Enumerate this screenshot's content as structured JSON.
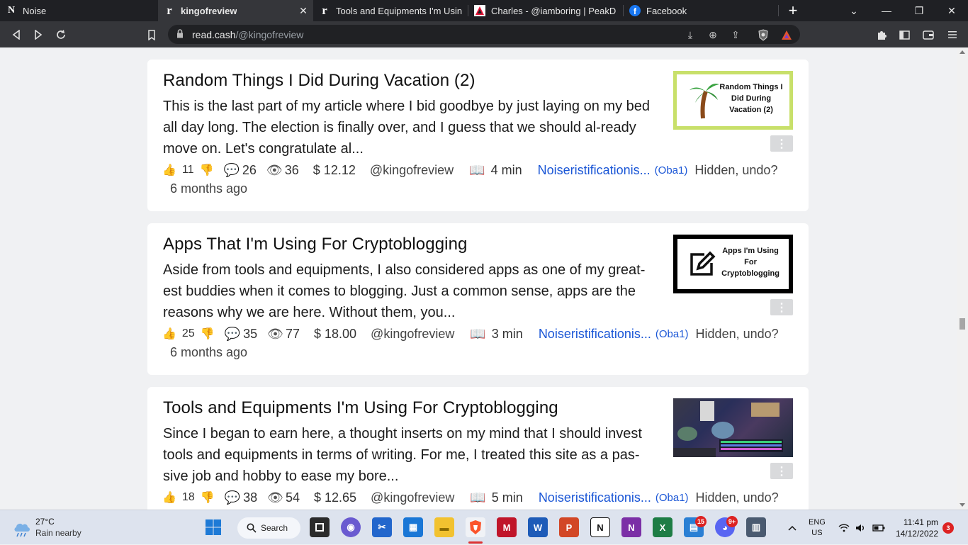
{
  "browser": {
    "tabs": [
      {
        "title": "Noise",
        "favicon": "N",
        "active": false
      },
      {
        "title": "kingofreview",
        "favicon": "r",
        "active": true
      },
      {
        "title": "Tools and Equipments I'm Using Fo",
        "favicon": "r",
        "active": false
      },
      {
        "title": "Charles - @iamboring | PeakD",
        "favicon": "peakd-icon",
        "active": false
      },
      {
        "title": "Facebook",
        "favicon": "facebook-icon",
        "active": false
      }
    ],
    "new_tab": "+",
    "url_domain": "read.cash",
    "url_path": "/@kingofreview"
  },
  "articles": [
    {
      "title": "Random Things I Did During Vacation (2)",
      "excerpt": "This is the last part of my article where I bid goodbye by just laying on my bed all day long. The election is finally over, and I guess that we should al-ready move on. Let's congratulate al...",
      "thumb_text": "Random Things I Did During Vacation (2)",
      "thumb_border": "#c8e06a",
      "likes": "11",
      "comments": "26",
      "views": "36",
      "earnings": "$ 12.12",
      "author": "@kingofreview",
      "read_time": "4 min",
      "community": "Noiseristificationis...",
      "community_owner": "(Oba1)",
      "hidden": "Hidden, undo?",
      "ago": "6 months ago"
    },
    {
      "title": "Apps That I'm Using For Cryptoblogging",
      "excerpt": "Aside from tools and equipments, I also considered apps as one of my great-est buddies when it comes to blogging. Just a common sense, apps are the reasons why we are here. Without them, you...",
      "thumb_text": "Apps I'm Using For Cryptoblogging",
      "thumb_border": "#000000",
      "likes": "25",
      "comments": "35",
      "views": "77",
      "earnings": "$ 18.00",
      "author": "@kingofreview",
      "read_time": "3 min",
      "community": "Noiseristificationis...",
      "community_owner": "(Oba1)",
      "hidden": "Hidden, undo?",
      "ago": "6 months ago"
    },
    {
      "title": "Tools and Equipments I'm Using For Cryptoblogging",
      "excerpt": "Since I began to earn here, a thought inserts on my mind that I should invest tools and equipments in terms of writing. For me, I treated this site as a pas-sive job and hobby to ease my bore...",
      "thumb_text": "",
      "thumb_border": "",
      "likes": "18",
      "comments": "38",
      "views": "54",
      "earnings": "$ 12.65",
      "author": "@kingofreview",
      "read_time": "5 min",
      "community": "Noiseristificationis...",
      "community_owner": "(Oba1)",
      "hidden": "Hidden, undo?",
      "ago": ""
    }
  ],
  "taskbar": {
    "weather_temp": "27°C",
    "weather_cond": "Rain nearby",
    "search_label": "Search",
    "teams_badge": "15",
    "discord_badge": "9+",
    "lang_top": "ENG",
    "lang_bottom": "US",
    "time": "11:41 pm",
    "date": "14/12/2022",
    "notif_count": "3"
  },
  "colors": {
    "link": "#1a56d6",
    "like": "#4a8fe7",
    "tab_bg": "#1f2024",
    "addr_bg": "#35363a",
    "page_bg": "#f0f1f3"
  }
}
